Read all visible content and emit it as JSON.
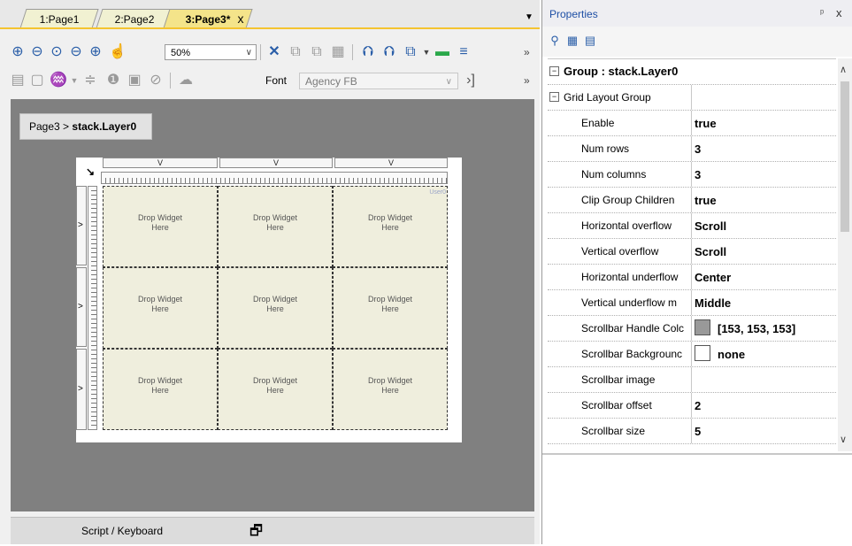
{
  "tabs": [
    {
      "label": "1:Page1"
    },
    {
      "label": "2:Page2"
    },
    {
      "label": "3:Page3*",
      "active": true
    }
  ],
  "tab_close": "x",
  "toolbar": {
    "zoom_value": "50%",
    "font_label": "Font",
    "font_value": "Agency FB",
    "overflow": "»"
  },
  "breadcrumb": {
    "page": "Page3",
    "separator": ">",
    "layer": "stack.Layer0"
  },
  "grid_layout": {
    "cells": [
      {
        "line1": "Drop Widget",
        "line2": "Here"
      },
      {
        "line1": "Drop Widget",
        "line2": "Here"
      },
      {
        "line1": "Drop Widget",
        "line2": "Here"
      },
      {
        "line1": "Drop Widget",
        "line2": "Here"
      },
      {
        "line1": "Drop Widget",
        "line2": "Here"
      },
      {
        "line1": "Drop Widget",
        "line2": "Here"
      },
      {
        "line1": "Drop Widget",
        "line2": "Here"
      },
      {
        "line1": "Drop Widget",
        "line2": "Here"
      },
      {
        "line1": "Drop Widget",
        "line2": "Here"
      }
    ],
    "col_markers": [
      "V",
      "V",
      "V"
    ],
    "row_markers": [
      ">",
      ">",
      ">"
    ],
    "corner_label": "User0"
  },
  "bottom_bar": {
    "label": "Script / Keyboard"
  },
  "properties": {
    "title": "Properties",
    "pin": "ᵖ",
    "close": "x",
    "group_header": "Group : stack.Layer0",
    "section_header": "Grid Layout Group",
    "rows": [
      {
        "name": "Enable",
        "value": "true"
      },
      {
        "name": "Num rows",
        "value": "3"
      },
      {
        "name": "Num columns",
        "value": "3"
      },
      {
        "name": "Clip Group Children",
        "value": "true"
      },
      {
        "name": "Horizontal overflow",
        "value": "Scroll"
      },
      {
        "name": "Vertical overflow",
        "value": "Scroll"
      },
      {
        "name": "Horizontal underflow",
        "value": "Center"
      },
      {
        "name": "Vertical underflow m",
        "value": "Middle"
      },
      {
        "name": "Scrollbar Handle Colc",
        "value": "[153, 153, 153]",
        "swatch": "#999999"
      },
      {
        "name": "Scrollbar Backgrounc",
        "value": "none",
        "swatch": "#ffffff"
      },
      {
        "name": "Scrollbar image",
        "value": ""
      },
      {
        "name": "Scrollbar offset",
        "value": "2"
      },
      {
        "name": "Scrollbar size",
        "value": "5"
      }
    ]
  },
  "colors": {
    "accent": "#2a5ea8",
    "tab_active": "#f4e48a",
    "tab_inactive": "#f1f1d2",
    "canvas": "#808080",
    "cell": "#efeedd"
  }
}
